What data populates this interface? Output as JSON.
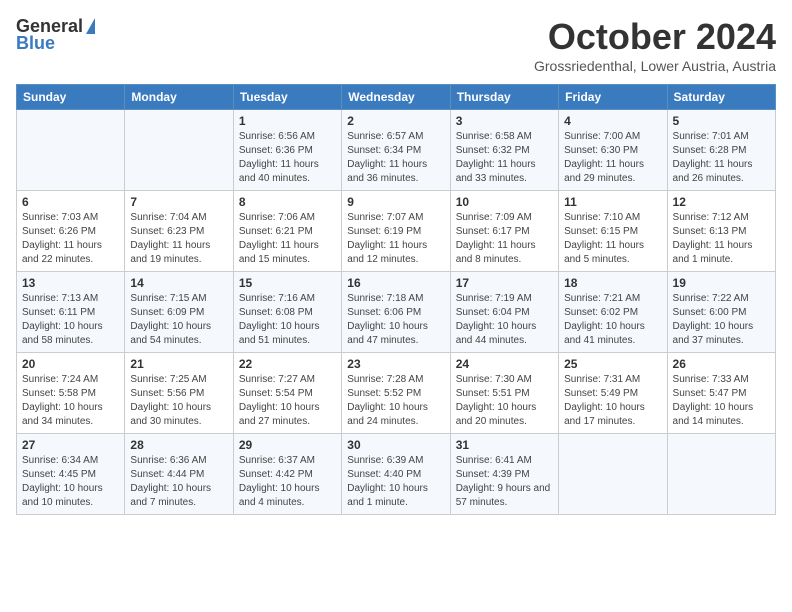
{
  "header": {
    "logo_general": "General",
    "logo_blue": "Blue",
    "month_title": "October 2024",
    "location": "Grossriedenthal, Lower Austria, Austria"
  },
  "calendar": {
    "weekdays": [
      "Sunday",
      "Monday",
      "Tuesday",
      "Wednesday",
      "Thursday",
      "Friday",
      "Saturday"
    ],
    "weeks": [
      [
        {
          "day": "",
          "info": ""
        },
        {
          "day": "",
          "info": ""
        },
        {
          "day": "1",
          "info": "Sunrise: 6:56 AM\nSunset: 6:36 PM\nDaylight: 11 hours and 40 minutes."
        },
        {
          "day": "2",
          "info": "Sunrise: 6:57 AM\nSunset: 6:34 PM\nDaylight: 11 hours and 36 minutes."
        },
        {
          "day": "3",
          "info": "Sunrise: 6:58 AM\nSunset: 6:32 PM\nDaylight: 11 hours and 33 minutes."
        },
        {
          "day": "4",
          "info": "Sunrise: 7:00 AM\nSunset: 6:30 PM\nDaylight: 11 hours and 29 minutes."
        },
        {
          "day": "5",
          "info": "Sunrise: 7:01 AM\nSunset: 6:28 PM\nDaylight: 11 hours and 26 minutes."
        }
      ],
      [
        {
          "day": "6",
          "info": "Sunrise: 7:03 AM\nSunset: 6:26 PM\nDaylight: 11 hours and 22 minutes."
        },
        {
          "day": "7",
          "info": "Sunrise: 7:04 AM\nSunset: 6:23 PM\nDaylight: 11 hours and 19 minutes."
        },
        {
          "day": "8",
          "info": "Sunrise: 7:06 AM\nSunset: 6:21 PM\nDaylight: 11 hours and 15 minutes."
        },
        {
          "day": "9",
          "info": "Sunrise: 7:07 AM\nSunset: 6:19 PM\nDaylight: 11 hours and 12 minutes."
        },
        {
          "day": "10",
          "info": "Sunrise: 7:09 AM\nSunset: 6:17 PM\nDaylight: 11 hours and 8 minutes."
        },
        {
          "day": "11",
          "info": "Sunrise: 7:10 AM\nSunset: 6:15 PM\nDaylight: 11 hours and 5 minutes."
        },
        {
          "day": "12",
          "info": "Sunrise: 7:12 AM\nSunset: 6:13 PM\nDaylight: 11 hours and 1 minute."
        }
      ],
      [
        {
          "day": "13",
          "info": "Sunrise: 7:13 AM\nSunset: 6:11 PM\nDaylight: 10 hours and 58 minutes."
        },
        {
          "day": "14",
          "info": "Sunrise: 7:15 AM\nSunset: 6:09 PM\nDaylight: 10 hours and 54 minutes."
        },
        {
          "day": "15",
          "info": "Sunrise: 7:16 AM\nSunset: 6:08 PM\nDaylight: 10 hours and 51 minutes."
        },
        {
          "day": "16",
          "info": "Sunrise: 7:18 AM\nSunset: 6:06 PM\nDaylight: 10 hours and 47 minutes."
        },
        {
          "day": "17",
          "info": "Sunrise: 7:19 AM\nSunset: 6:04 PM\nDaylight: 10 hours and 44 minutes."
        },
        {
          "day": "18",
          "info": "Sunrise: 7:21 AM\nSunset: 6:02 PM\nDaylight: 10 hours and 41 minutes."
        },
        {
          "day": "19",
          "info": "Sunrise: 7:22 AM\nSunset: 6:00 PM\nDaylight: 10 hours and 37 minutes."
        }
      ],
      [
        {
          "day": "20",
          "info": "Sunrise: 7:24 AM\nSunset: 5:58 PM\nDaylight: 10 hours and 34 minutes."
        },
        {
          "day": "21",
          "info": "Sunrise: 7:25 AM\nSunset: 5:56 PM\nDaylight: 10 hours and 30 minutes."
        },
        {
          "day": "22",
          "info": "Sunrise: 7:27 AM\nSunset: 5:54 PM\nDaylight: 10 hours and 27 minutes."
        },
        {
          "day": "23",
          "info": "Sunrise: 7:28 AM\nSunset: 5:52 PM\nDaylight: 10 hours and 24 minutes."
        },
        {
          "day": "24",
          "info": "Sunrise: 7:30 AM\nSunset: 5:51 PM\nDaylight: 10 hours and 20 minutes."
        },
        {
          "day": "25",
          "info": "Sunrise: 7:31 AM\nSunset: 5:49 PM\nDaylight: 10 hours and 17 minutes."
        },
        {
          "day": "26",
          "info": "Sunrise: 7:33 AM\nSunset: 5:47 PM\nDaylight: 10 hours and 14 minutes."
        }
      ],
      [
        {
          "day": "27",
          "info": "Sunrise: 6:34 AM\nSunset: 4:45 PM\nDaylight: 10 hours and 10 minutes."
        },
        {
          "day": "28",
          "info": "Sunrise: 6:36 AM\nSunset: 4:44 PM\nDaylight: 10 hours and 7 minutes."
        },
        {
          "day": "29",
          "info": "Sunrise: 6:37 AM\nSunset: 4:42 PM\nDaylight: 10 hours and 4 minutes."
        },
        {
          "day": "30",
          "info": "Sunrise: 6:39 AM\nSunset: 4:40 PM\nDaylight: 10 hours and 1 minute."
        },
        {
          "day": "31",
          "info": "Sunrise: 6:41 AM\nSunset: 4:39 PM\nDaylight: 9 hours and 57 minutes."
        },
        {
          "day": "",
          "info": ""
        },
        {
          "day": "",
          "info": ""
        }
      ]
    ]
  }
}
